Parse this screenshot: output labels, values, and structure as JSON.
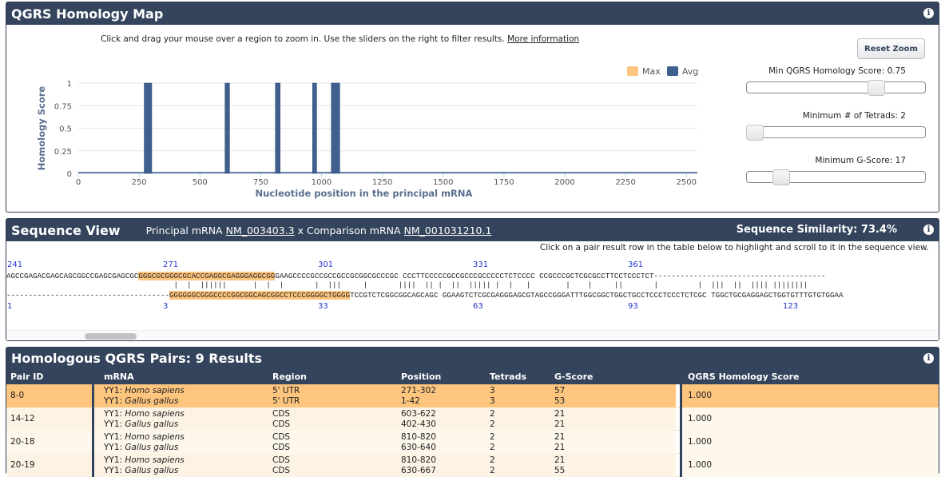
{
  "map_panel": {
    "title": "QGRS Homology Map",
    "instructions": "Click and drag your mouse over a region to zoom in. Use the sliders on the right to filter results.",
    "more_info_link": "More information",
    "reset_zoom_label": "Reset Zoom",
    "sliders": [
      {
        "label": "Min QGRS Homology Score: 0.75",
        "value": 0.75,
        "min": 0,
        "max": 1
      },
      {
        "label": "Minimum # of Tetrads: 2",
        "value": 2,
        "min": 2,
        "max": 6
      },
      {
        "label": "Minimum G-Score: 17",
        "value": 17,
        "min": 0,
        "max": 105
      }
    ]
  },
  "chart_data": {
    "type": "bar",
    "xlabel": "Nucleotide position in the principal mRNA",
    "ylabel": "Homology Score",
    "xlim": [
      0,
      2600
    ],
    "ylim": [
      0,
      1
    ],
    "xticks": [
      0,
      250,
      500,
      750,
      1000,
      1250,
      1500,
      1750,
      2000,
      2250,
      2500
    ],
    "yticks": [
      0,
      0.25,
      0.5,
      0.75,
      1
    ],
    "ytick_labels": [
      "0",
      "0.25",
      "0.5",
      "0.75",
      "1"
    ],
    "legend": [
      {
        "name": "Max",
        "color": "#fdc57e"
      },
      {
        "name": "Avg",
        "color": "#3f5f8f"
      }
    ],
    "legend_position": "top-right",
    "series": [
      {
        "name": "Avg",
        "color": "#3f5f8f",
        "bars": [
          {
            "start": 271,
            "end": 302,
            "value": 1
          },
          {
            "start": 603,
            "end": 622,
            "value": 1
          },
          {
            "start": 810,
            "end": 830,
            "value": 1
          },
          {
            "start": 963,
            "end": 980,
            "value": 1
          },
          {
            "start": 1040,
            "end": 1075,
            "value": 1
          }
        ]
      }
    ]
  },
  "sequence_panel": {
    "title": "Sequence View",
    "principal_prefix": "Principal mRNA",
    "principal_id": "NM_003403.3",
    "connector": "x Comparison mRNA",
    "comparison_id": "NM_001031210.1",
    "similarity": "Sequence Similarity: 73.4%",
    "instructions": "Click on a pair result row in the table below to highlight and scroll to it in the sequence view.",
    "top_numbers": [
      "241",
      "271",
      "301",
      "331",
      "361"
    ],
    "bottom_numbers": [
      "1",
      "3",
      "33",
      "63",
      "93",
      "123"
    ],
    "top_seq_a": "AGCCGAGACGAGCAGCGGCCGAGCGAGCGC",
    "top_seq_hl": "GGGCGCGGGCGCACCGAGGCGAGGGAGGCGG",
    "top_seq_b": "GAAGCCCCGCCGCCGCCGCGGCGCCCGC CCCTTCCCCCGCCGCCCGCCCCCTCTCCCC CCGCCCGCTCGCGCCTTCCTCCCTCT---------------------------------------",
    "match_line": "                                      |  |  ||||||      |  |  |       |  |||     |       ||||  || |  ||  ||||| |  |   |        |    |     ||       |         |  |||  ||  |||| ||||||||",
    "bottom_seq_a": "-------------------------------------",
    "bottom_seq_hl": "GGGGGGCGGGCCCCGGCGGCAGCGGCCTCCCGGGGCTGGGG",
    "bottom_seq_b": "TCCGTCTCGGCGGCAGCAGC GGAAGTCTCGCGAGGGAGCGTAGCCGGGATTTGGCGGCTGGCTGCCTCCCTCCCTCTCGC TGGCTGCGAGGAGCTGGTGTTTGTGTGGAA"
  },
  "pairs_panel": {
    "title": "Homologous QGRS Pairs: 9 Results",
    "columns": [
      "Pair ID",
      "mRNA",
      "Region",
      "Position",
      "Tetrads",
      "G-Score",
      "QGRS Homology Score"
    ],
    "rows": [
      {
        "id": "8-0",
        "gene1": "YY1:",
        "species1": "Homo sapiens",
        "gene2": "YY1:",
        "species2": "Gallus gallus",
        "region1": "5' UTR",
        "region2": "5' UTR",
        "pos1": "271-302",
        "pos2": "1-42",
        "tet1": "3",
        "tet2": "3",
        "g1": "57",
        "g2": "53",
        "score": "1.000",
        "selected": true
      },
      {
        "id": "14-12",
        "gene1": "YY1:",
        "species1": "Homo sapiens",
        "gene2": "YY1:",
        "species2": "Gallus gallus",
        "region1": "CDS",
        "region2": "CDS",
        "pos1": "603-622",
        "pos2": "402-430",
        "tet1": "2",
        "tet2": "2",
        "g1": "21",
        "g2": "21",
        "score": "1.000",
        "selected": false
      },
      {
        "id": "20-18",
        "gene1": "YY1:",
        "species1": "Homo sapiens",
        "gene2": "YY1:",
        "species2": "Gallus gallus",
        "region1": "CDS",
        "region2": "CDS",
        "pos1": "810-820",
        "pos2": "630-640",
        "tet1": "2",
        "tet2": "2",
        "g1": "21",
        "g2": "21",
        "score": "1.000",
        "selected": false
      },
      {
        "id": "20-19",
        "gene1": "YY1:",
        "species1": "Homo sapiens",
        "gene2": "YY1:",
        "species2": "Gallus gallus",
        "region1": "CDS",
        "region2": "CDS",
        "pos1": "810-820",
        "pos2": "630-667",
        "tet1": "2",
        "tet2": "2",
        "g1": "21",
        "g2": "55",
        "score": "1.000",
        "selected": false
      }
    ]
  }
}
